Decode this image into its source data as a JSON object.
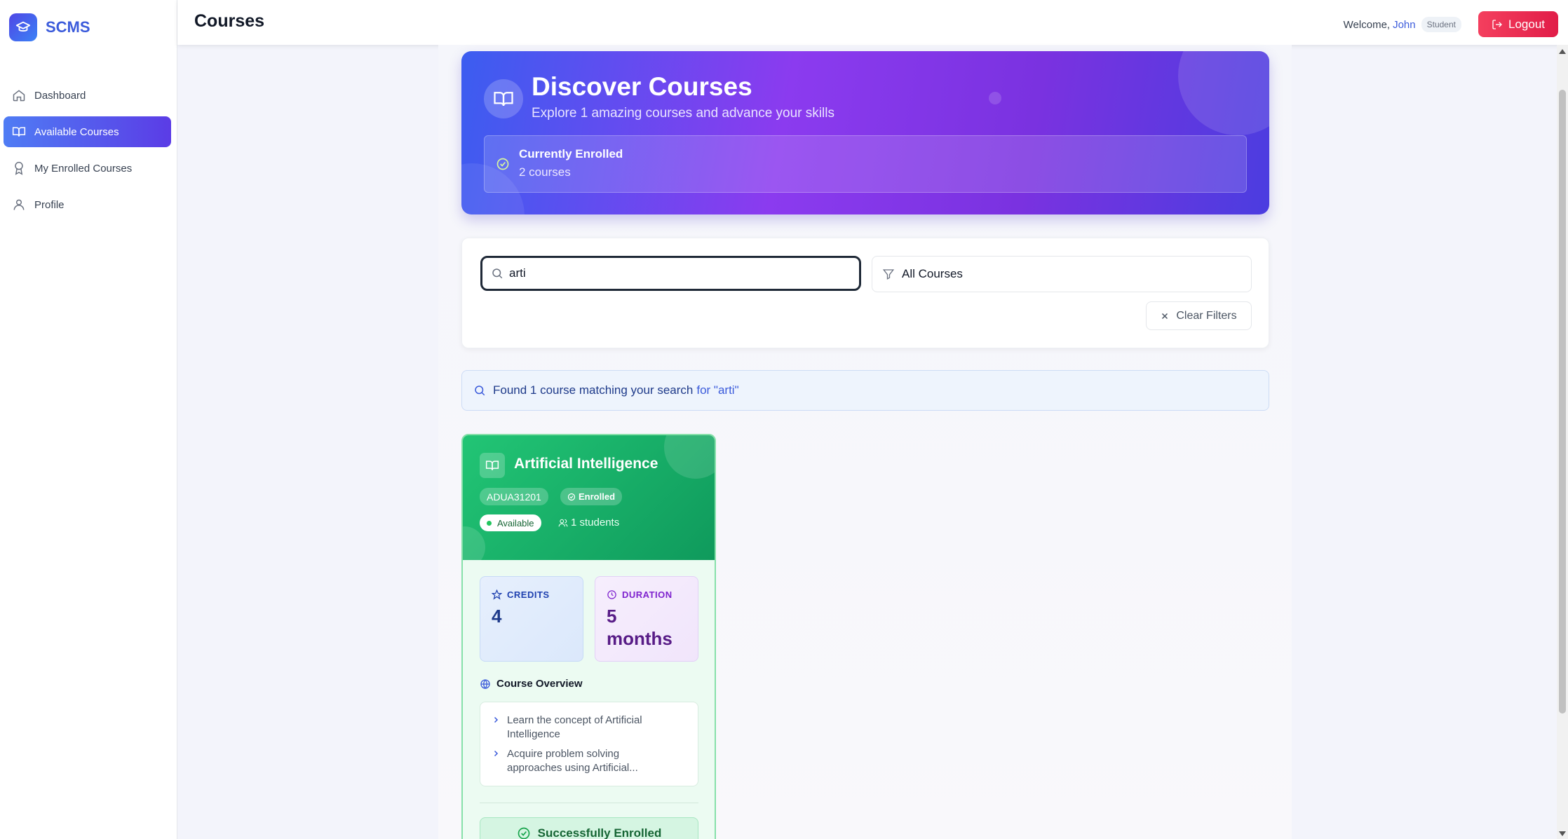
{
  "app": {
    "name": "SCMS",
    "logo_icon": "graduation-cap-icon"
  },
  "sidebar": {
    "items": [
      {
        "label": "Dashboard",
        "icon": "home-icon",
        "active": false
      },
      {
        "label": "Available Courses",
        "icon": "book-open-icon",
        "active": true
      },
      {
        "label": "My Enrolled Courses",
        "icon": "award-icon",
        "active": false
      },
      {
        "label": "Profile",
        "icon": "user-icon",
        "active": false
      }
    ]
  },
  "header": {
    "title": "Courses",
    "welcome_prefix": "Welcome,",
    "user_name": "John",
    "role": "Student",
    "logout_label": "Logout"
  },
  "hero": {
    "title": "Discover Courses",
    "subtitle": "Explore 1 amazing courses and advance your skills",
    "enrolled_label": "Currently Enrolled",
    "enrolled_count": "2 courses"
  },
  "filters": {
    "search_value": "arti",
    "category_selected": "All Courses",
    "clear_label": "Clear Filters"
  },
  "results": {
    "found_text": "Found 1 course matching your search",
    "query_text": "for \"arti\""
  },
  "course": {
    "title": "Artificial Intelligence",
    "code": "ADUA31201",
    "enrolled_badge": "Enrolled",
    "status": "Available",
    "students": "1 students",
    "credits_label": "CREDITS",
    "credits_value": "4",
    "duration_label": "DURATION",
    "duration_value": "5 months",
    "overview_title": "Course Overview",
    "overview_items": [
      "Learn the concept of Artificial Intelligence",
      "Acquire problem solving approaches using Artificial..."
    ],
    "success_label": "Successfully Enrolled"
  },
  "colors": {
    "brand": "#3b5bdb",
    "active_nav": "#5b3ce6",
    "logout": "#e11d48",
    "card_green": "#0f9a5c"
  }
}
